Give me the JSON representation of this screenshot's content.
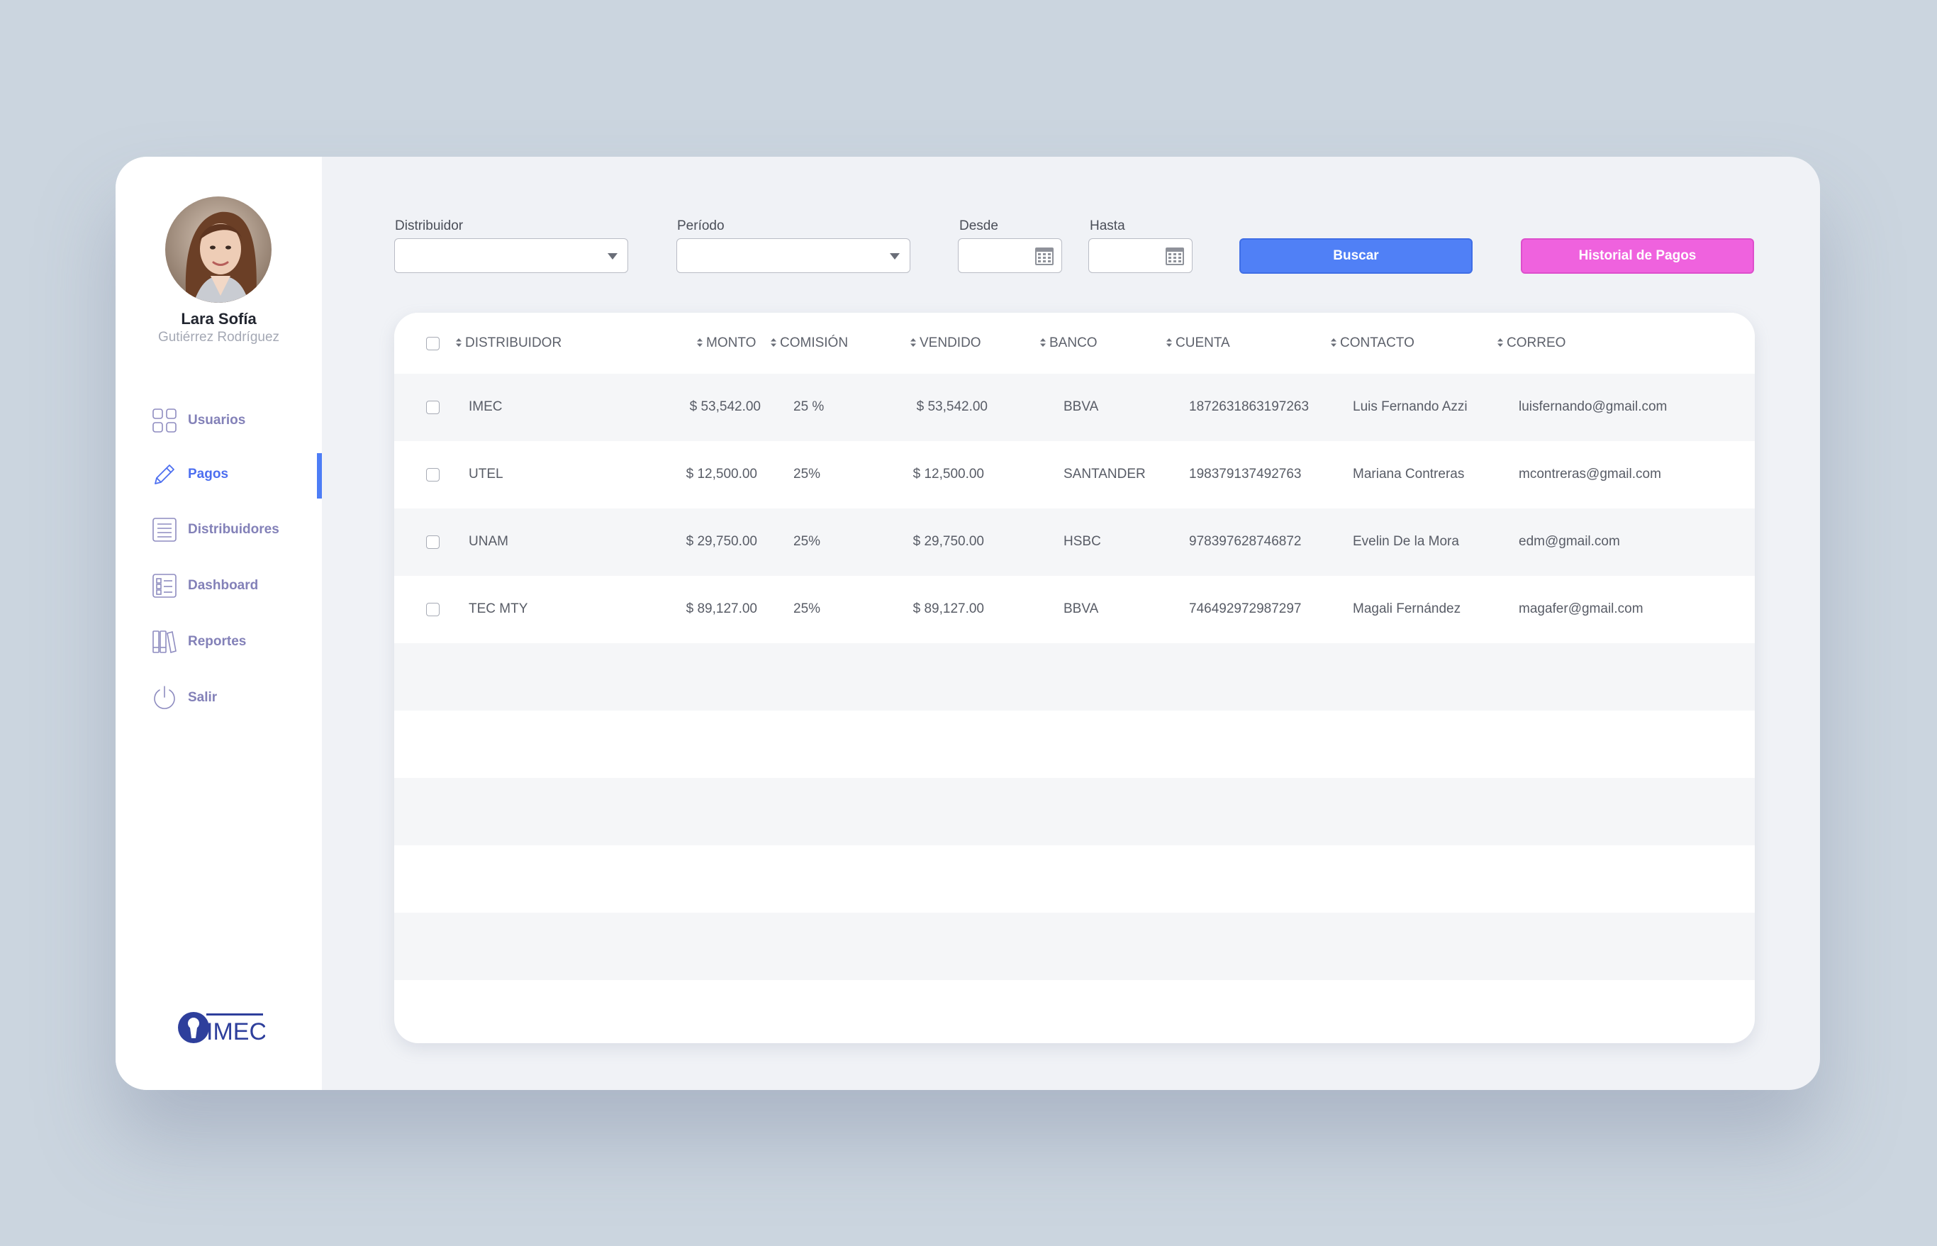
{
  "user": {
    "first_name": "Lara Sofía",
    "last_name": "Gutiérrez Rodríguez"
  },
  "sidebar": {
    "items": [
      {
        "label": "Usuarios",
        "icon": "grid-icon",
        "active": false
      },
      {
        "label": "Pagos",
        "icon": "pencil-icon",
        "active": true
      },
      {
        "label": "Distribuidores",
        "icon": "list-icon",
        "active": false
      },
      {
        "label": "Dashboard",
        "icon": "checklist-icon",
        "active": false
      },
      {
        "label": "Reportes",
        "icon": "books-icon",
        "active": false
      },
      {
        "label": "Salir",
        "icon": "power-icon",
        "active": false
      }
    ],
    "logo_text": "IMEC"
  },
  "filters": {
    "distribuidor_label": "Distribuidor",
    "periodo_label": "Período",
    "desde_label": "Desde",
    "hasta_label": "Hasta",
    "search_button": "Buscar",
    "history_button": "Historial de Pagos"
  },
  "table": {
    "headers": [
      "DISTRIBUIDOR",
      "MONTO",
      "COMISIÓN",
      "VENDIDO",
      "BANCO",
      "CUENTA",
      "CONTACTO",
      "CORREO"
    ],
    "rows": [
      [
        "IMEC",
        "$ 53,542.00",
        "25 %",
        "$ 53,542.00",
        "BBVA",
        "1872631863197263",
        "Luis Fernando Azzi",
        "luisfernando@gmail.com"
      ],
      [
        "UTEL",
        "$ 12,500.00",
        "25%",
        "$ 12,500.00",
        "SANTANDER",
        "198379137492763",
        "Mariana Contreras",
        "mcontreras@gmail.com"
      ],
      [
        "UNAM",
        "$ 29,750.00",
        "25%",
        "$ 29,750.00",
        "HSBC",
        "978397628746872",
        "Evelin De la Mora",
        "edm@gmail.com"
      ],
      [
        "TEC MTY",
        "$ 89,127.00",
        "25%",
        "$ 89,127.00",
        "BBVA",
        "746492972987297",
        "Magali Fernández",
        "magafer@gmail.com"
      ]
    ]
  },
  "colors": {
    "accent": "#5080f6",
    "history": "#ef62de",
    "nav_text": "#8381b8",
    "background": "#cbd5df"
  }
}
